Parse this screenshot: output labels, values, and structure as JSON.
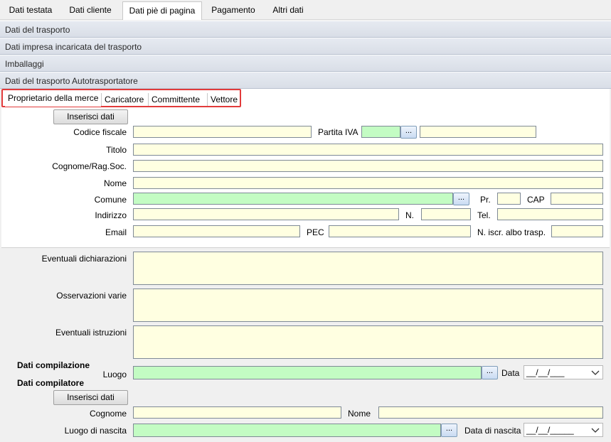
{
  "top_tabs": [
    {
      "label": "Dati testata"
    },
    {
      "label": "Dati cliente"
    },
    {
      "label": "Dati piè di pagina"
    },
    {
      "label": "Pagamento"
    },
    {
      "label": "Altri dati"
    }
  ],
  "active_top_tab": "Dati piè di pagina",
  "accordion": [
    {
      "label": "Dati del trasporto"
    },
    {
      "label": "Dati impresa incaricata del trasporto"
    },
    {
      "label": "Imballaggi"
    },
    {
      "label": "Dati del trasporto Autotrasportatore"
    }
  ],
  "inner_tabs": [
    {
      "label": "Proprietario della merce"
    },
    {
      "label": "Caricatore"
    },
    {
      "label": "Committente"
    },
    {
      "label": "Vettore"
    }
  ],
  "active_inner_tab": "Proprietario della merce",
  "owner_form": {
    "insert_button": "Inserisci dati",
    "codice_fiscale": {
      "label": "Codice fiscale",
      "value": ""
    },
    "partita_iva": {
      "label": "Partita IVA",
      "prefix": "",
      "value": ""
    },
    "lookup_button": "...",
    "titolo": {
      "label": "Titolo",
      "value": ""
    },
    "cognome": {
      "label": "Cognome/Rag.Soc.",
      "value": ""
    },
    "nome": {
      "label": "Nome",
      "value": ""
    },
    "comune": {
      "label": "Comune",
      "value": ""
    },
    "provincia": {
      "label": "Pr.",
      "value": ""
    },
    "cap": {
      "label": "CAP",
      "value": ""
    },
    "indirizzo": {
      "label": "Indirizzo",
      "value": ""
    },
    "numero": {
      "label": "N.",
      "value": ""
    },
    "tel": {
      "label": "Tel.",
      "value": ""
    },
    "email": {
      "label": "Email",
      "value": ""
    },
    "pec": {
      "label": "PEC",
      "value": ""
    },
    "albo": {
      "label": "N. iscr. albo trasp.",
      "value": ""
    }
  },
  "notes": {
    "dichiarazioni": {
      "label": "Eventuali dichiarazioni",
      "value": ""
    },
    "osservazioni": {
      "label": "Osservazioni varie",
      "value": ""
    },
    "istruzioni": {
      "label": "Eventuali istruzioni",
      "value": ""
    }
  },
  "compilazione": {
    "heading": "Dati compilazione",
    "luogo": {
      "label": "Luogo",
      "value": ""
    },
    "data": {
      "label": "Data",
      "value": "__/__/___"
    }
  },
  "compilatore": {
    "heading": "Dati compilatore",
    "insert_button": "Inserisci dati",
    "cognome": {
      "label": "Cognome",
      "value": ""
    },
    "nome": {
      "label": "Nome",
      "value": ""
    },
    "luogo_nascita": {
      "label": "Luogo di nascita",
      "value": ""
    },
    "data_nascita": {
      "label": "Data di nascita",
      "value": "__/__/_____"
    }
  },
  "colors": {
    "field_yellow": "#ffffe1",
    "field_green": "#c3fcc3",
    "highlight_red": "#e23b3b"
  }
}
